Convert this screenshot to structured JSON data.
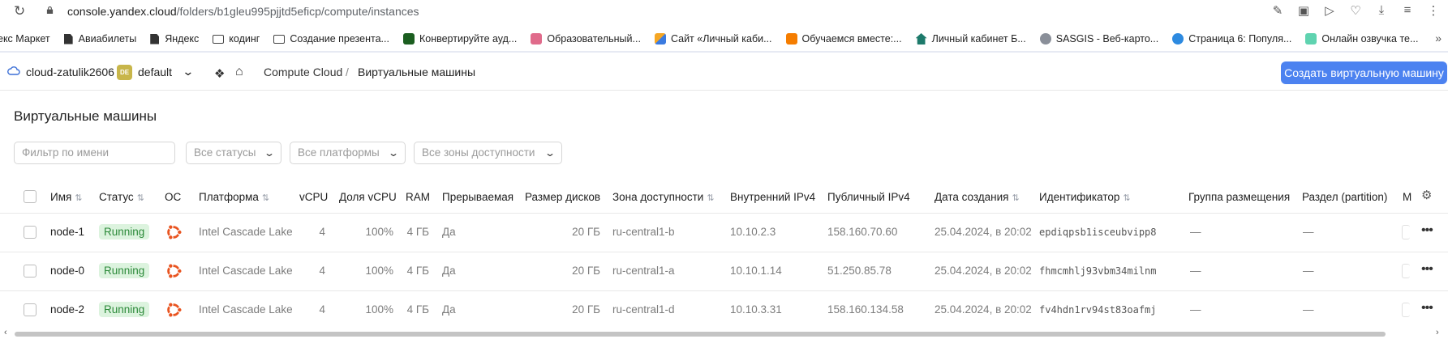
{
  "browser": {
    "url_host": "console.yandex.cloud",
    "url_path": "/folders/b1gleu995pjjtd5eficp/compute/instances"
  },
  "bookmarks": [
    {
      "label": "екс Маркет",
      "icon": "none"
    },
    {
      "label": "Авиабилеты",
      "icon": "doc"
    },
    {
      "label": "Яндекс",
      "icon": "doc"
    },
    {
      "label": "кодинг",
      "icon": "folder"
    },
    {
      "label": "Создание презента...",
      "icon": "folder"
    },
    {
      "label": "Конвертируйте ауд...",
      "icon": "green"
    },
    {
      "label": "Образовательный...",
      "icon": "pink"
    },
    {
      "label": "Сайт «Личный каби...",
      "icon": "orange-blue"
    },
    {
      "label": "Обучаемся вместе:...",
      "icon": "orange"
    },
    {
      "label": "Личный кабинет Б...",
      "icon": "teal-house"
    },
    {
      "label": "SASGIS - Веб-карто...",
      "icon": "gray-globe"
    },
    {
      "label": "Страница 6: Популя...",
      "icon": "blue-circle"
    },
    {
      "label": "Онлайн озвучка те...",
      "icon": "mint"
    }
  ],
  "header": {
    "cloud_name": "cloud-zatulik2606",
    "folder_badge": "DE",
    "folder_name": "default",
    "breadcrumb_service": "Compute Cloud",
    "breadcrumb_sep": "/",
    "breadcrumb_page": "Виртуальные машины",
    "create_button": "Создать виртуальную машину"
  },
  "page_title": "Виртуальные машины",
  "filters": {
    "name_placeholder": "Фильтр по имени",
    "status": "Все статусы",
    "platform": "Все платформы",
    "zone": "Все зоны доступности"
  },
  "columns": {
    "name": "Имя",
    "status": "Статус",
    "os": "ОС",
    "platform": "Платформа",
    "vcpu": "vCPU",
    "vcpu_share": "Доля vCPU",
    "ram": "RAM",
    "preemptible": "Прерываемая",
    "disk_size": "Размер дисков",
    "zone": "Зона доступности",
    "internal_ip": "Внутренний IPv4",
    "public_ip": "Публичный IPv4",
    "created": "Дата создания",
    "id": "Идентификатор",
    "placement_group": "Группа размещения",
    "partition": "Раздел (partition)",
    "last": "М"
  },
  "rows": [
    {
      "name": "node-1",
      "status": "Running",
      "platform": "Intel Cascade Lake",
      "vcpu": "4",
      "vcpu_share": "100%",
      "ram": "4 ГБ",
      "preemptible": "Да",
      "disk_size": "20 ГБ",
      "zone": "ru-central1-b",
      "internal_ip": "10.10.2.3",
      "public_ip": "158.160.70.60",
      "created": "25.04.2024, в 20:02",
      "id": "epdiqpsb1isceubvipp8",
      "placement_group": "—",
      "partition": "—"
    },
    {
      "name": "node-0",
      "status": "Running",
      "platform": "Intel Cascade Lake",
      "vcpu": "4",
      "vcpu_share": "100%",
      "ram": "4 ГБ",
      "preemptible": "Да",
      "disk_size": "20 ГБ",
      "zone": "ru-central1-a",
      "internal_ip": "10.10.1.14",
      "public_ip": "51.250.85.78",
      "created": "25.04.2024, в 20:02",
      "id": "fhmcmhlj93vbm34milnm",
      "placement_group": "—",
      "partition": "—"
    },
    {
      "name": "node-2",
      "status": "Running",
      "platform": "Intel Cascade Lake",
      "vcpu": "4",
      "vcpu_share": "100%",
      "ram": "4 ГБ",
      "preemptible": "Да",
      "disk_size": "20 ГБ",
      "zone": "ru-central1-d",
      "internal_ip": "10.10.3.31",
      "public_ip": "158.160.134.58",
      "created": "25.04.2024, в 20:02",
      "id": "fv4hdn1rv94st83oafmj",
      "placement_group": "—",
      "partition": "—"
    }
  ],
  "colors": {
    "accent": "#4c82f0",
    "status_bg": "#dcf3de",
    "status_text": "#2c8a3a",
    "ubuntu": "#e95420"
  }
}
